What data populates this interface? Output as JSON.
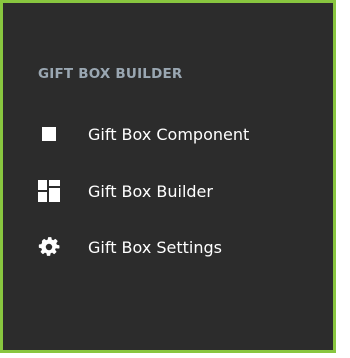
{
  "sidebar": {
    "section_title": "GIFT BOX BUILDER",
    "items": [
      {
        "label": "Gift Box Component",
        "icon": "square-icon"
      },
      {
        "label": "Gift Box Builder",
        "icon": "layout-grid-icon"
      },
      {
        "label": "Gift Box Settings",
        "icon": "gear-icon"
      }
    ]
  },
  "colors": {
    "panel_background": "#2c2c2c",
    "accent_border": "#88c63f",
    "section_title": "#9aa7b2",
    "item_text": "#ffffff"
  }
}
